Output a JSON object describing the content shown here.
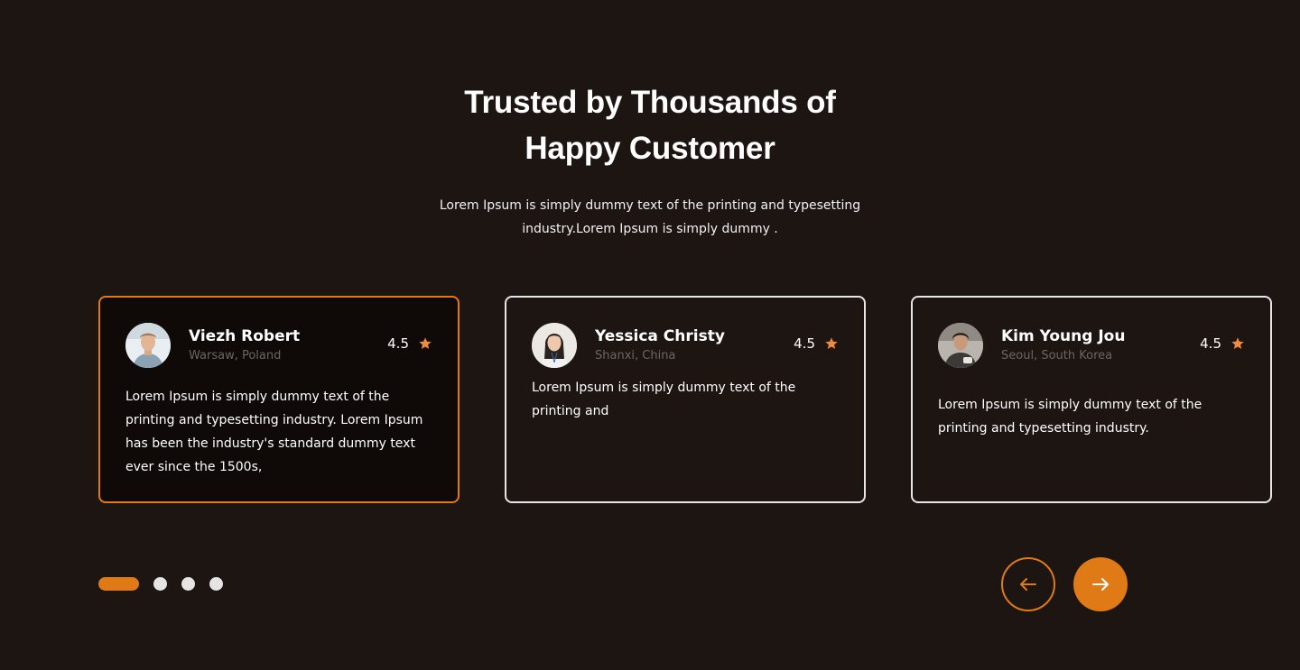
{
  "section": {
    "title_line1": "Trusted by Thousands of",
    "title_line2": "Happy Customer",
    "subtitle_line1": "Lorem Ipsum is simply dummy text of the printing and typesetting",
    "subtitle_line2": "industry.Lorem Ipsum is simply dummy ."
  },
  "testimonials": [
    {
      "name": "Viezh Robert",
      "location": "Warsaw, Poland",
      "rating": "4.5",
      "text": "Lorem Ipsum is simply dummy text of the printing and typesetting industry. Lorem Ipsum has been the industry's standard dummy text ever since the 1500s,",
      "active": true
    },
    {
      "name": "Yessica Christy",
      "location": "Shanxi, China",
      "rating": "4.5",
      "text": "Lorem Ipsum is simply dummy text of the printing and",
      "active": false
    },
    {
      "name": "Kim Young Jou",
      "location": "Seoul, South Korea",
      "rating": "4.5",
      "text": "Lorem Ipsum is simply dummy text of the printing and typesetting industry.",
      "active": false
    }
  ],
  "pagination": {
    "total": 4,
    "current": 1
  },
  "icons": {
    "rating": "star-icon",
    "prev": "arrow-left-icon",
    "next": "arrow-right-icon"
  },
  "colors": {
    "background": "#1c1512",
    "accent": "#e07a16",
    "star": "#f08a3c",
    "muted_text": "#6c6560"
  }
}
